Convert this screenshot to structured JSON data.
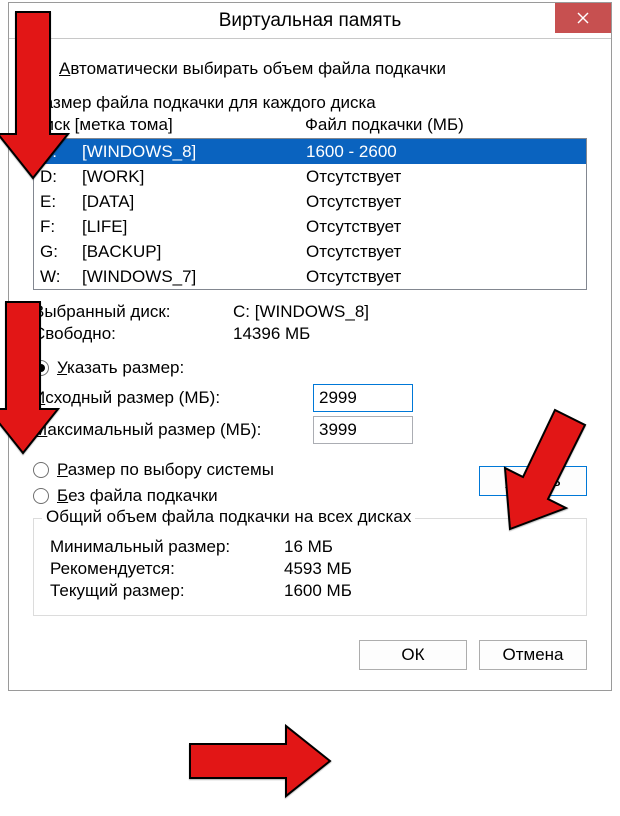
{
  "window_title": "Виртуальная память",
  "auto_checkbox_label_pre": "А",
  "auto_checkbox_label_post": "втоматически выбирать объем файла подкачки",
  "section_size_per_drive": "Размер файла подкачки для каждого диска",
  "col_drive_pre": "Д",
  "col_drive_post": "иск [метка тома]",
  "col_pagefile": "Файл подкачки (МБ)",
  "drives": [
    {
      "letter": "C:",
      "label": "[WINDOWS_8]",
      "pagefile": "1600 - 2600",
      "selected": true
    },
    {
      "letter": "D:",
      "label": "[WORK]",
      "pagefile": "Отсутствует",
      "selected": false
    },
    {
      "letter": "E:",
      "label": "[DATA]",
      "pagefile": "Отсутствует",
      "selected": false
    },
    {
      "letter": "F:",
      "label": "[LIFE]",
      "pagefile": "Отсутствует",
      "selected": false
    },
    {
      "letter": "G:",
      "label": "[BACKUP]",
      "pagefile": "Отсутствует",
      "selected": false
    },
    {
      "letter": "W:",
      "label": "[WINDOWS_7]",
      "pagefile": "Отсутствует",
      "selected": false
    }
  ],
  "selected_drive_label": "Выбранный диск:",
  "selected_drive_value": "C:  [WINDOWS_8]",
  "free_space_label": "Свободно:",
  "free_space_value": "14396 МБ",
  "radio_custom_pre": "У",
  "radio_custom_post": "казать размер:",
  "initial_size_pre": "И",
  "initial_size_post": "сходный размер (МБ):",
  "initial_size_value": "2999",
  "max_size_pre": "М",
  "max_size_post": "аксимальный размер (МБ):",
  "max_size_value": "3999",
  "radio_system_pre": "Р",
  "radio_system_post": "азмер по выбору системы",
  "radio_none_pre": "Б",
  "radio_none_post": "ез файла подкачки",
  "set_button_pre": "З",
  "set_button_post": "адать",
  "groupbox_title": "Общий объем файла подкачки на всех дисках",
  "min_label": "Минимальный размер:",
  "min_value": "16 МБ",
  "rec_label": "Рекомендуется:",
  "rec_value": "4593 МБ",
  "cur_label": "Текущий размер:",
  "cur_value": "1600 МБ",
  "ok_label": "ОК",
  "cancel_label": "Отмена"
}
